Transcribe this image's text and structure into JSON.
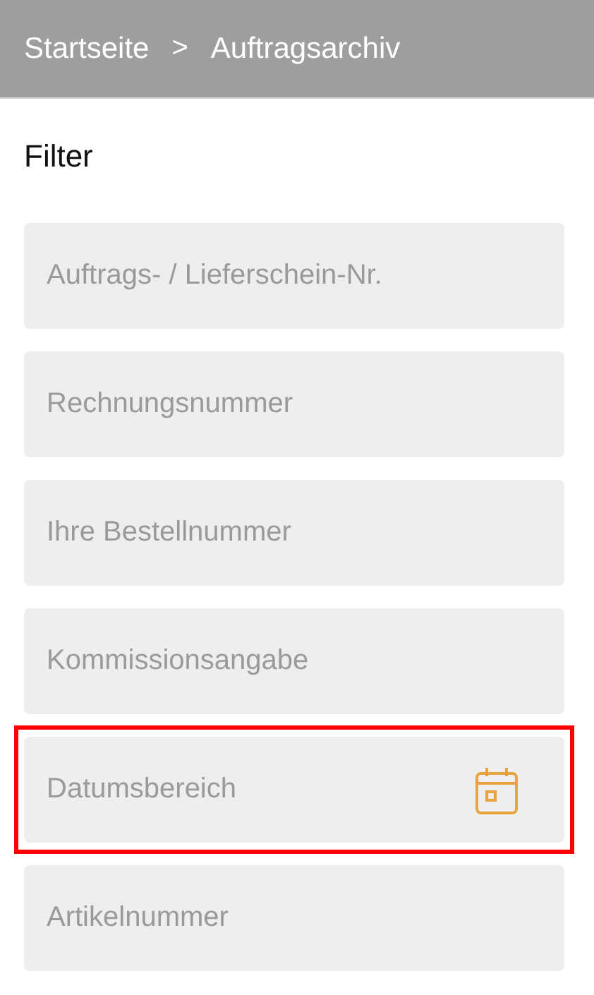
{
  "breadcrumb": {
    "items": [
      "Startseite",
      "Auftragsarchiv"
    ],
    "separator": ">"
  },
  "filter": {
    "title": "Filter",
    "fields": [
      {
        "kind": "text",
        "placeholder": "Auftrags- / Lieferschein-Nr.",
        "highlighted": false
      },
      {
        "kind": "text",
        "placeholder": "Rechnungsnummer",
        "highlighted": false
      },
      {
        "kind": "text",
        "placeholder": "Ihre Bestellnummer",
        "highlighted": false
      },
      {
        "kind": "text",
        "placeholder": "Kommissionsangabe",
        "highlighted": false
      },
      {
        "kind": "date",
        "placeholder": "Datumsbereich",
        "highlighted": true
      },
      {
        "kind": "text",
        "placeholder": "Artikelnummer",
        "highlighted": false
      }
    ]
  }
}
